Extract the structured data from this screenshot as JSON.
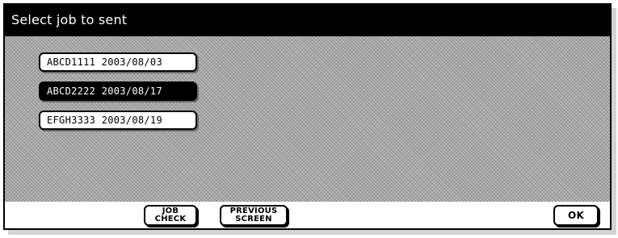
{
  "title": "Select job to sent",
  "jobs": [
    {
      "label": "ABCD1111 2003/08/03",
      "selected": false
    },
    {
      "label": "ABCD2222 2003/08/17",
      "selected": true
    },
    {
      "label": "EFGH3333 2003/08/19",
      "selected": false
    }
  ],
  "footer": {
    "job_check_line1": "JOB",
    "job_check_line2": "CHECK",
    "previous_line1": "PREVIOUS",
    "previous_line2": "SCREEN",
    "ok_label": "OK"
  },
  "colors": {
    "title_bar": "#000000",
    "selected_item": "#000000",
    "content_background": "#b9b9b9"
  }
}
